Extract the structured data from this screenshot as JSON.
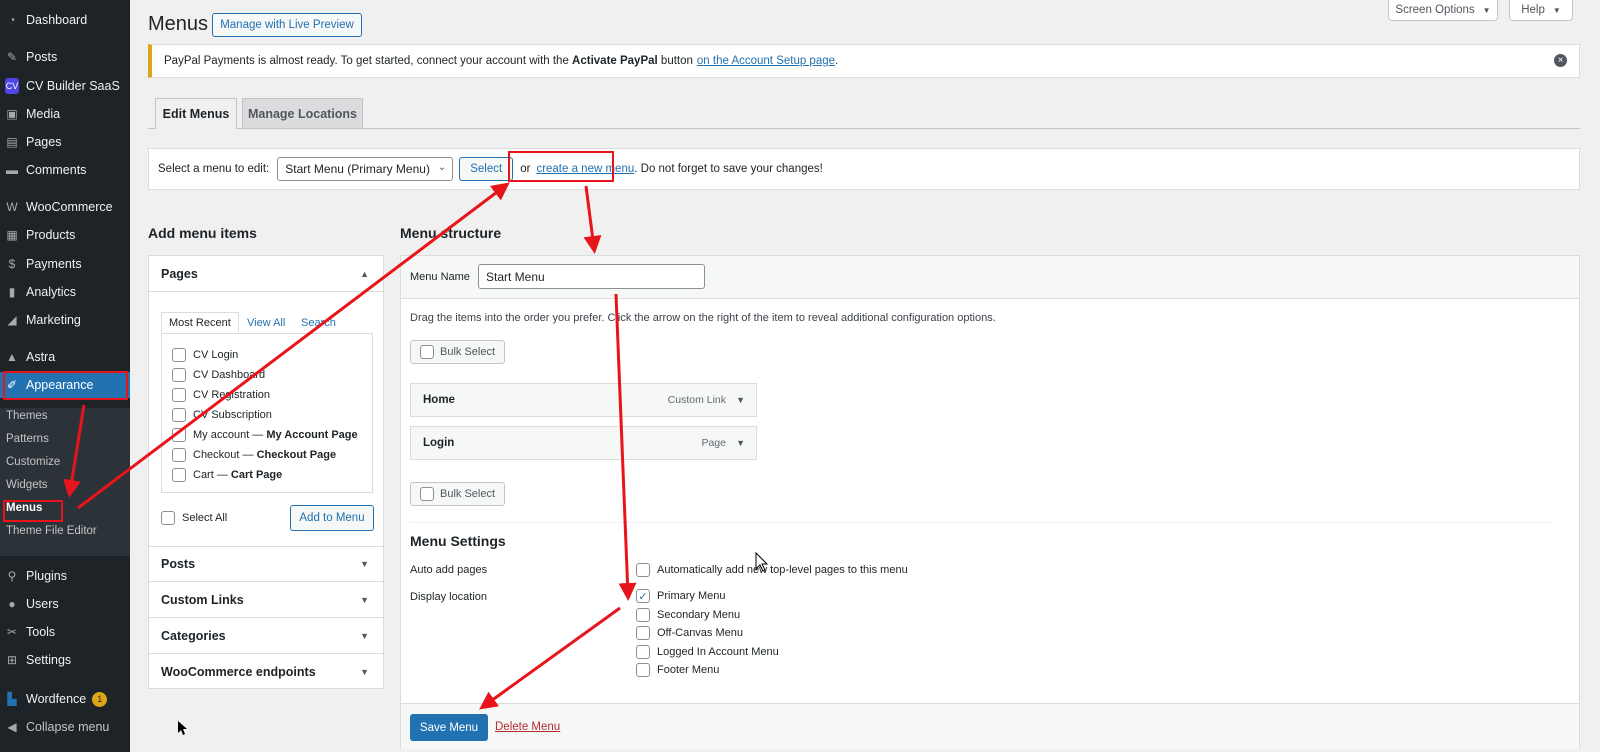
{
  "sidebar": {
    "items": [
      {
        "label": "Dashboard",
        "icon": "dashboard-icon"
      },
      {
        "label": "Posts",
        "icon": "pin-icon"
      },
      {
        "label": "CV Builder SaaS",
        "icon": "cv-builder-icon"
      },
      {
        "label": "Media",
        "icon": "media-icon"
      },
      {
        "label": "Pages",
        "icon": "pages-icon"
      },
      {
        "label": "Comments",
        "icon": "comments-icon"
      },
      {
        "label": "WooCommerce",
        "icon": "woocommerce-icon"
      },
      {
        "label": "Products",
        "icon": "products-icon"
      },
      {
        "label": "Payments",
        "icon": "payments-icon"
      },
      {
        "label": "Analytics",
        "icon": "analytics-icon"
      },
      {
        "label": "Marketing",
        "icon": "marketing-icon"
      },
      {
        "label": "Astra",
        "icon": "astra-icon"
      },
      {
        "label": "Appearance",
        "icon": "brush-icon"
      },
      {
        "label": "Plugins",
        "icon": "plugins-icon"
      },
      {
        "label": "Users",
        "icon": "users-icon"
      },
      {
        "label": "Tools",
        "icon": "wrench-icon"
      },
      {
        "label": "Settings",
        "icon": "settings-icon"
      },
      {
        "label": "Wordfence",
        "icon": "wordfence-icon",
        "badge": "1"
      },
      {
        "label": "Collapse menu",
        "icon": "collapse-icon"
      }
    ],
    "cv_icon_text": "CV",
    "appearance_submenu": [
      "Themes",
      "Patterns",
      "Customize",
      "Widgets",
      "Menus",
      "Theme File Editor"
    ]
  },
  "header": {
    "title": "Menus",
    "live_preview": "Manage with Live Preview",
    "screen_options": "Screen Options",
    "help": "Help"
  },
  "notice": {
    "text_before": "PayPal Payments is almost ready. To get started, connect your account with the",
    "bold": "Activate PayPal",
    "text_mid": "button",
    "link": "on the Account Setup page",
    "text_after": "."
  },
  "tabs": {
    "edit": "Edit Menus",
    "locations": "Manage Locations"
  },
  "select_bar": {
    "label": "Select a menu to edit:",
    "selected": "Start Menu (Primary Menu)",
    "select_button": "Select",
    "or": "or",
    "create_link": "create a new menu",
    "tail": ". Do not forget to save your changes!"
  },
  "add_items": {
    "heading": "Add menu items",
    "pages_title": "Pages",
    "inner_tabs": [
      "Most Recent",
      "View All",
      "Search"
    ],
    "pages": [
      {
        "label": "CV Login",
        "bold": ""
      },
      {
        "label": "CV Dashboard",
        "bold": ""
      },
      {
        "label": "CV Registration",
        "bold": ""
      },
      {
        "label": "CV Subscription",
        "bold": ""
      },
      {
        "label": "My account — ",
        "bold": "My Account Page"
      },
      {
        "label": "Checkout — ",
        "bold": "Checkout Page"
      },
      {
        "label": "Cart — ",
        "bold": "Cart Page"
      }
    ],
    "select_all": "Select All",
    "add_button": "Add to Menu",
    "sections": [
      "Posts",
      "Custom Links",
      "Categories",
      "WooCommerce endpoints"
    ]
  },
  "structure": {
    "heading": "Menu structure",
    "name_label": "Menu Name",
    "name_value": "Start Menu",
    "instructions": "Drag the items into the order you prefer. Click the arrow on the right of the item to reveal additional configuration options.",
    "bulk_select": "Bulk Select",
    "items": [
      {
        "title": "Home",
        "type": "Custom Link"
      },
      {
        "title": "Login",
        "type": "Page"
      }
    ]
  },
  "settings": {
    "heading": "Menu Settings",
    "auto_add_label": "Auto add pages",
    "auto_add_option": "Automatically add new top-level pages to this menu",
    "display_label": "Display location",
    "locations": [
      {
        "label": "Primary Menu",
        "checked": true
      },
      {
        "label": "Secondary Menu",
        "checked": false
      },
      {
        "label": "Off-Canvas Menu",
        "checked": false
      },
      {
        "label": "Logged In Account Menu",
        "checked": false
      },
      {
        "label": "Footer Menu",
        "checked": false
      }
    ],
    "save": "Save Menu",
    "delete": "Delete Menu"
  },
  "colors": {
    "accent": "#2271b1",
    "sidebar": "#1d2327",
    "annotation": "#e8141b"
  }
}
